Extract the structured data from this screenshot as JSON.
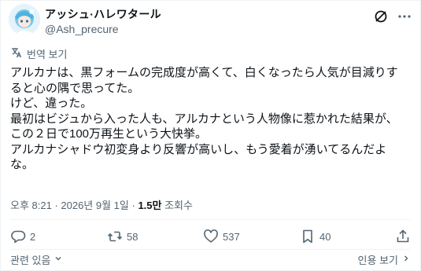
{
  "author": {
    "display_name": "アッシュ·ハレワタール",
    "handle": "@Ash_precure"
  },
  "translate_label": "번역 보기",
  "post_lines": [
    "アルカナは、黒フォームの完成度が高くて、白くなったら人気が目減りす",
    "ると心の隅で思ってた。",
    "けど、違った。",
    "最初はビジュから入った人も、アルカナという人物像に惹かれた結果が、",
    "この２日で100万再生という大快挙。",
    "アルカナシャドウ初変身より反響が高いし、もう愛着が湧いてるんだよ",
    "な。"
  ],
  "meta": {
    "datetime": "오후 8:21 · 2026년 9월 1일 · ",
    "views_count": "1.5만",
    "views_label": " 조회수"
  },
  "actions": {
    "replies": "2",
    "reposts": "58",
    "likes": "537",
    "bookmarks": "40"
  },
  "footer": {
    "related_label": "관련 있음",
    "quotes_label": "인용 보기"
  },
  "colors": {
    "text": "#0f1419",
    "secondary": "#536471",
    "border": "#eff3f4"
  }
}
